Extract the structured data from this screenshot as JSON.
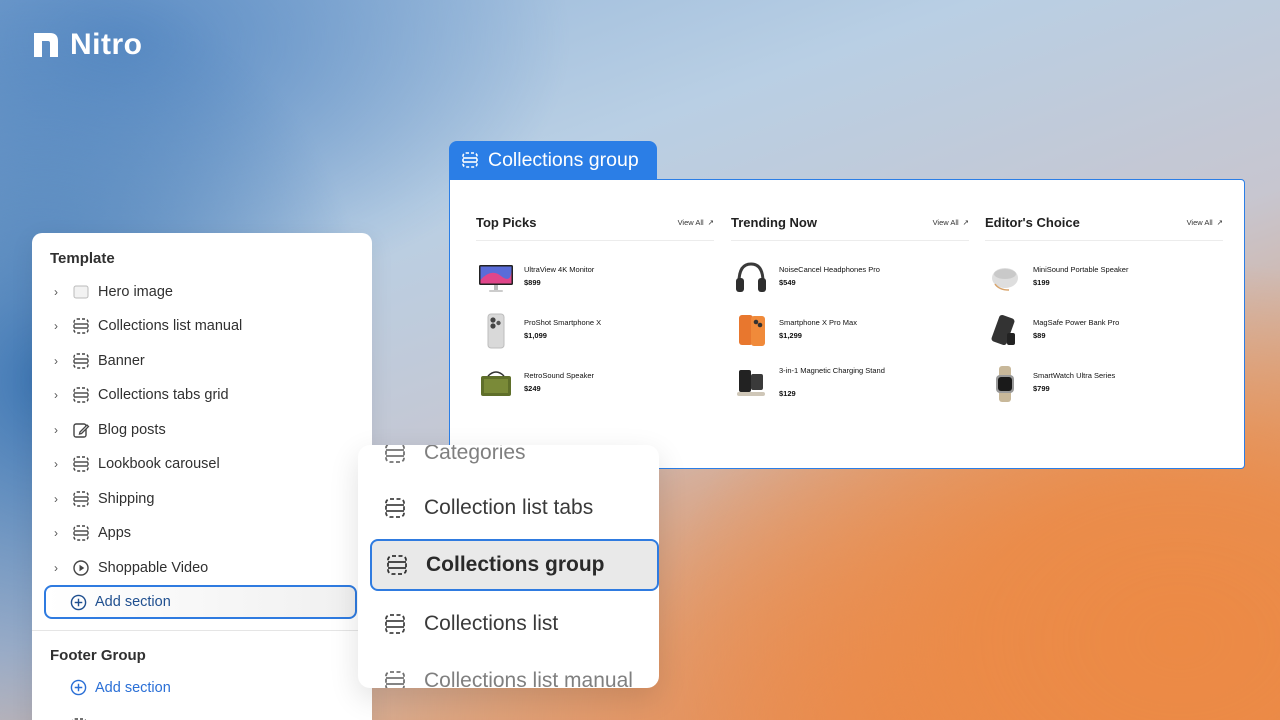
{
  "brand": {
    "name": "Nitro"
  },
  "template_panel": {
    "heading": "Template",
    "items": [
      {
        "label": "Hero image",
        "icon": "image-icon"
      },
      {
        "label": "Collections list manual",
        "icon": "section-icon"
      },
      {
        "label": "Banner",
        "icon": "section-icon"
      },
      {
        "label": "Collections tabs grid",
        "icon": "section-icon"
      },
      {
        "label": "Blog posts",
        "icon": "edit-icon"
      },
      {
        "label": "Lookbook carousel",
        "icon": "section-icon"
      },
      {
        "label": "Shipping",
        "icon": "section-icon"
      },
      {
        "label": "Apps",
        "icon": "section-icon"
      },
      {
        "label": "Shoppable Video",
        "icon": "play-icon"
      }
    ],
    "add_section": "Add section",
    "footer_heading": "Footer Group",
    "footer_add_section": "Add section"
  },
  "section_picker": {
    "items": [
      {
        "label": "Categories",
        "state": "cut-off"
      },
      {
        "label": "Collection list tabs",
        "state": "normal"
      },
      {
        "label": "Collections group",
        "state": "selected"
      },
      {
        "label": "Collections list",
        "state": "normal"
      },
      {
        "label": "Collections list manual",
        "state": "cut-off"
      }
    ]
  },
  "collections_group": {
    "tag_label": "Collections group",
    "view_all_label": "View All",
    "columns": [
      {
        "title": "Top Picks",
        "products": [
          {
            "name": "UltraView 4K Monitor",
            "price": "$899"
          },
          {
            "name": "ProShot Smartphone X",
            "price": "$1,099"
          },
          {
            "name": "RetroSound Speaker",
            "price": "$249"
          }
        ]
      },
      {
        "title": "Trending Now",
        "products": [
          {
            "name": "NoiseCancel Headphones Pro",
            "price": "$549"
          },
          {
            "name": "Smartphone X Pro Max",
            "price": "$1,299"
          },
          {
            "name": "3-in-1 Magnetic Charging Stand",
            "price": "$129"
          }
        ]
      },
      {
        "title": "Editor's Choice",
        "products": [
          {
            "name": "MiniSound Portable Speaker",
            "price": "$199"
          },
          {
            "name": "MagSafe Power Bank Pro",
            "price": "$89"
          },
          {
            "name": "SmartWatch Ultra Series",
            "price": "$799"
          }
        ]
      }
    ]
  },
  "colors": {
    "accent": "#2b7ee6",
    "link": "#2a6fd6"
  }
}
